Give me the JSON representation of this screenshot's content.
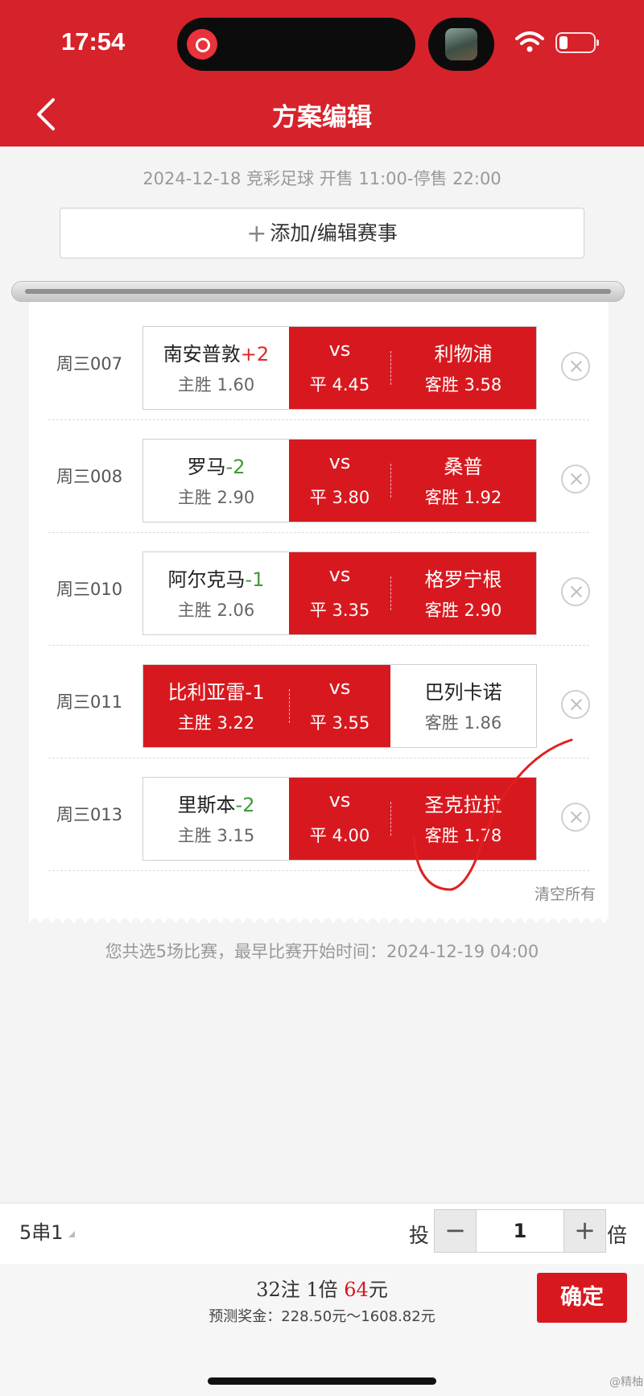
{
  "status_bar": {
    "time": "17:54"
  },
  "nav": {
    "title": "方案编辑"
  },
  "sale_info": "2024-12-18 竞彩足球 开售 11:00-停售 22:00",
  "add_button": {
    "plus": "+",
    "label": "添加/编辑赛事"
  },
  "matches": [
    {
      "code": "周三007",
      "home": "南安普敦",
      "handicap": "+2",
      "home_odds": "主胜 1.60",
      "vs": "vs",
      "draw_odds": "平 4.45",
      "away": "利物浦",
      "away_odds": "客胜 3.58",
      "selected": [
        "draw",
        "away"
      ]
    },
    {
      "code": "周三008",
      "home": "罗马",
      "handicap": "-2",
      "home_odds": "主胜 2.90",
      "vs": "vs",
      "draw_odds": "平 3.80",
      "away": "桑普",
      "away_odds": "客胜 1.92",
      "selected": [
        "draw",
        "away"
      ]
    },
    {
      "code": "周三010",
      "home": "阿尔克马",
      "handicap": "-1",
      "home_odds": "主胜 2.06",
      "vs": "vs",
      "draw_odds": "平 3.35",
      "away": "格罗宁根",
      "away_odds": "客胜 2.90",
      "selected": [
        "draw",
        "away"
      ]
    },
    {
      "code": "周三011",
      "home": "比利亚雷",
      "handicap": "-1",
      "home_odds": "主胜 3.22",
      "vs": "vs",
      "draw_odds": "平 3.55",
      "away": "巴列卡诺",
      "away_odds": "客胜 1.86",
      "selected": [
        "home",
        "draw"
      ]
    },
    {
      "code": "周三013",
      "home": "里斯本",
      "handicap": "-2",
      "home_odds": "主胜 3.15",
      "vs": "vs",
      "draw_odds": "平 4.00",
      "away": "圣克拉拉",
      "away_odds": "客胜 1.78",
      "selected": [
        "draw",
        "away"
      ]
    }
  ],
  "clear_all": "清空所有",
  "summary": "您共选5场比赛，最早比赛开始时间：2024-12-19 04:00",
  "bet_bar": {
    "combo": "5串1",
    "tou": "投",
    "minus": "−",
    "multiplier": "1",
    "plus": "+",
    "bei": "倍"
  },
  "footer": {
    "bets_prefix": "32注 1倍 ",
    "amount": "64",
    "currency": "元",
    "prize": "预测奖金：228.50元～1608.82元",
    "confirm": "确定"
  },
  "watermark": "@精柚",
  "colors": {
    "primary_red": "#d7191f",
    "handicap_positive": "#e0262d",
    "handicap_negative": "#3f9a3a"
  }
}
